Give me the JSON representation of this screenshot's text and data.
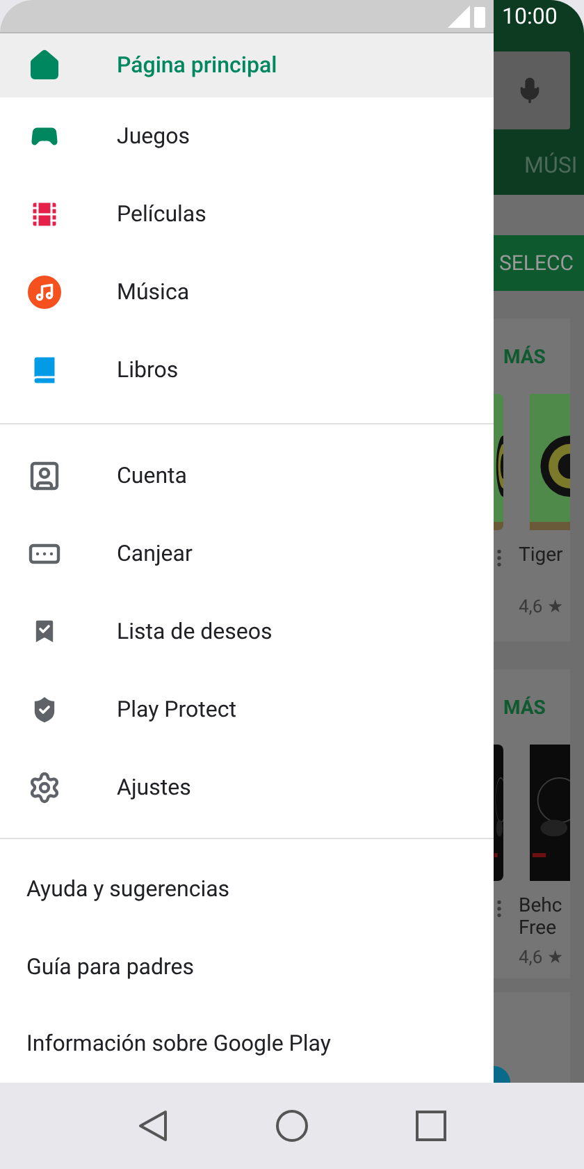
{
  "status_bar": {
    "time": "10:00"
  },
  "drawer": {
    "primary": [
      {
        "label": "Página principal",
        "kind": "home",
        "selected": true
      },
      {
        "label": "Juegos",
        "kind": "games",
        "selected": false
      },
      {
        "label": "Películas",
        "kind": "movies",
        "selected": false
      },
      {
        "label": "Música",
        "kind": "music",
        "selected": false
      },
      {
        "label": "Libros",
        "kind": "books",
        "selected": false
      }
    ],
    "secondary": [
      {
        "label": "Cuenta",
        "kind": "account"
      },
      {
        "label": "Canjear",
        "kind": "redeem"
      },
      {
        "label": "Lista de deseos",
        "kind": "wishlist"
      },
      {
        "label": "Play Protect",
        "kind": "protect"
      },
      {
        "label": "Ajustes",
        "kind": "settings"
      }
    ],
    "links": [
      "Ayuda y sugerencias",
      "Guía para padres",
      "Información sobre Google Play"
    ]
  },
  "background": {
    "tab": "MÚSI",
    "chip": "SELECC",
    "cards": [
      {
        "more": "MÁS",
        "title_lines": [
          "Tiger"
        ],
        "rating": "4,6 ★"
      },
      {
        "more": "MÁS",
        "title_lines": [
          "Behc",
          "Free"
        ],
        "rating": "4,6 ★"
      }
    ]
  }
}
